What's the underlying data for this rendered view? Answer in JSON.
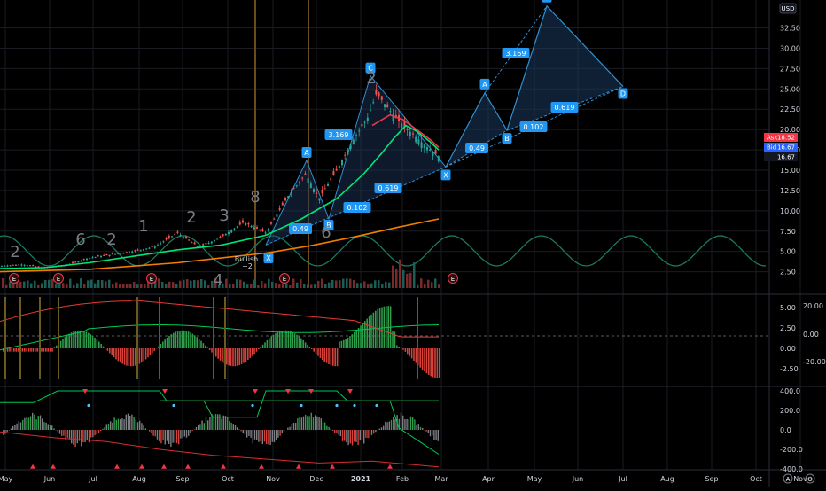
{
  "currency": "USD",
  "chart_data": [
    {
      "type": "line",
      "pane": "price",
      "y_axis_ticks": [
        "32.50",
        "30.00",
        "27.50",
        "25.00",
        "22.50",
        "20.00",
        "17.50",
        "15.00",
        "12.50",
        "10.00",
        "7.50",
        "5.00",
        "2.50"
      ],
      "x_axis_ticks": [
        "May",
        "Jun",
        "Jul",
        "Aug",
        "Sep",
        "Oct",
        "Nov",
        "Dec",
        "2021",
        "Feb",
        "Mar",
        "Apr",
        "May",
        "Jun",
        "Jul",
        "Aug",
        "Sep",
        "Oct",
        "Nov"
      ],
      "ylim": [
        0.5,
        35
      ],
      "price_tags": [
        {
          "label": "Ask",
          "value": "18.52",
          "color": "#f23645"
        },
        {
          "label": "Bid",
          "value": "16.67",
          "color": "#2962ff"
        },
        {
          "label": "",
          "value": "16.67",
          "color": "#131722"
        }
      ],
      "series": [
        {
          "name": "",
          "color": "#26a69a",
          "points": [
            [
              0,
              3.2
            ],
            [
              25,
              3.4
            ],
            [
              50,
              3.0
            ],
            [
              75,
              3.3
            ],
            [
              100,
              4.2
            ],
            [
              125,
              4.6
            ],
            [
              150,
              5.0
            ],
            [
              175,
              5.6
            ],
            [
              200,
              7.3
            ],
            [
              225,
              5.5
            ],
            [
              250,
              6.8
            ],
            [
              275,
              8.6
            ],
            [
              300,
              7.3
            ],
            [
              325,
              11.8
            ],
            [
              345,
              14.5
            ],
            [
              360,
              11.5
            ],
            [
              380,
              15.0
            ],
            [
              400,
              19.0
            ],
            [
              415,
              21.5
            ],
            [
              425,
              24.5
            ],
            [
              435,
              23.0
            ],
            [
              450,
              21.0
            ],
            [
              465,
              19.5
            ],
            [
              480,
              18.0
            ],
            [
              495,
              16.7
            ]
          ]
        },
        {
          "name": "",
          "color": "#00e676",
          "points": [
            [
              0,
              2.9
            ],
            [
              50,
              3.0
            ],
            [
              100,
              3.6
            ],
            [
              150,
              4.4
            ],
            [
              200,
              5.2
            ],
            [
              250,
              5.8
            ],
            [
              300,
              7.0
            ],
            [
              340,
              9.0
            ],
            [
              380,
              11.5
            ],
            [
              410,
              14.5
            ],
            [
              430,
              17.0
            ],
            [
              445,
              19.0
            ],
            [
              458,
              20.5
            ],
            [
              470,
              19.8
            ],
            [
              485,
              18.5
            ],
            [
              495,
              17.5
            ]
          ]
        },
        {
          "name": "",
          "color": "#f57c00",
          "points": [
            [
              0,
              2.5
            ],
            [
              100,
              2.8
            ],
            [
              200,
              3.6
            ],
            [
              300,
              4.8
            ],
            [
              350,
              5.7
            ],
            [
              400,
              6.8
            ],
            [
              450,
              8.0
            ],
            [
              495,
              9.0
            ]
          ]
        },
        {
          "name": "",
          "color": "#f23645",
          "points": [
            [
              420,
              20.5
            ],
            [
              440,
              21.8
            ],
            [
              455,
              21.2
            ],
            [
              470,
              20.0
            ],
            [
              485,
              18.8
            ],
            [
              495,
              17.8
            ]
          ]
        }
      ],
      "harmonic_pattern": {
        "points": [
          {
            "label": "X",
            "t": 503,
            "v": 15.4
          },
          {
            "label": "A",
            "t": 547,
            "v": 24.5
          },
          {
            "label": "B",
            "t": 572,
            "v": 19.9
          },
          {
            "label": "C",
            "t": 617,
            "v": 35.2
          },
          {
            "label": "D",
            "t": 703,
            "v": 25.3
          }
        ],
        "ratios": [
          "0.49",
          "0.102",
          "3.169",
          "0.619"
        ]
      },
      "historic_pattern": {
        "points": [
          {
            "label": "A",
            "t": 346,
            "v": 16.2
          },
          {
            "label": "B",
            "t": 371,
            "v": 9.0
          },
          {
            "label": "C",
            "t": 418,
            "v": 26.6
          }
        ],
        "ratios": [
          "3.169",
          "0.49",
          "0.102",
          "0.619"
        ]
      },
      "annotations": [
        "Bullish",
        "+2"
      ],
      "wave_counts": [
        "2",
        "6",
        "2",
        "1",
        "2",
        "3",
        "8",
        "4",
        "6",
        "2"
      ],
      "earnings_markers": [
        "E",
        "E",
        "E",
        "E",
        "E"
      ]
    },
    {
      "type": "bar",
      "pane": "momentum",
      "y_axis_ticks": [
        "5.00",
        "2.50",
        "0.00",
        "-2.50"
      ],
      "secondary_ticks": [
        "20.00",
        "0.00",
        "-20.00"
      ],
      "ylim": [
        -3.5,
        6.5
      ]
    },
    {
      "type": "bar",
      "pane": "oscillator",
      "y_axis_ticks": [
        "400.0",
        "200.0",
        "0.0",
        "-200.0",
        "-400.0"
      ],
      "ylim": [
        -450,
        450
      ]
    }
  ]
}
